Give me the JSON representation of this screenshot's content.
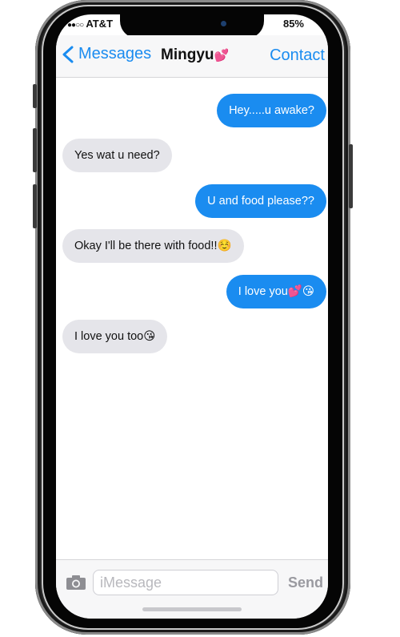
{
  "status_bar": {
    "carrier": "AT&T",
    "battery": "85%"
  },
  "nav": {
    "back_label": "Messages",
    "title": "Mingyu",
    "title_emoji": "💕",
    "contact_label": "Contact"
  },
  "messages": [
    {
      "direction": "out",
      "text": "Hey.....u awake?"
    },
    {
      "direction": "in",
      "text": "Yes wat u need?"
    },
    {
      "direction": "out",
      "text": "U and food please??"
    },
    {
      "direction": "in",
      "text": "Okay I'll be there with food!!☺️"
    },
    {
      "direction": "out",
      "text": "I love you💕😘"
    },
    {
      "direction": "in",
      "text": "I love you too😘"
    }
  ],
  "composer": {
    "placeholder": "iMessage",
    "send_label": "Send"
  },
  "colors": {
    "accent": "#1a8cf0",
    "incoming_bubble": "#e5e5ea",
    "outgoing_bubble": "#1a8cf0"
  },
  "icons": {
    "back": "chevron-left-icon",
    "camera": "camera-icon"
  }
}
